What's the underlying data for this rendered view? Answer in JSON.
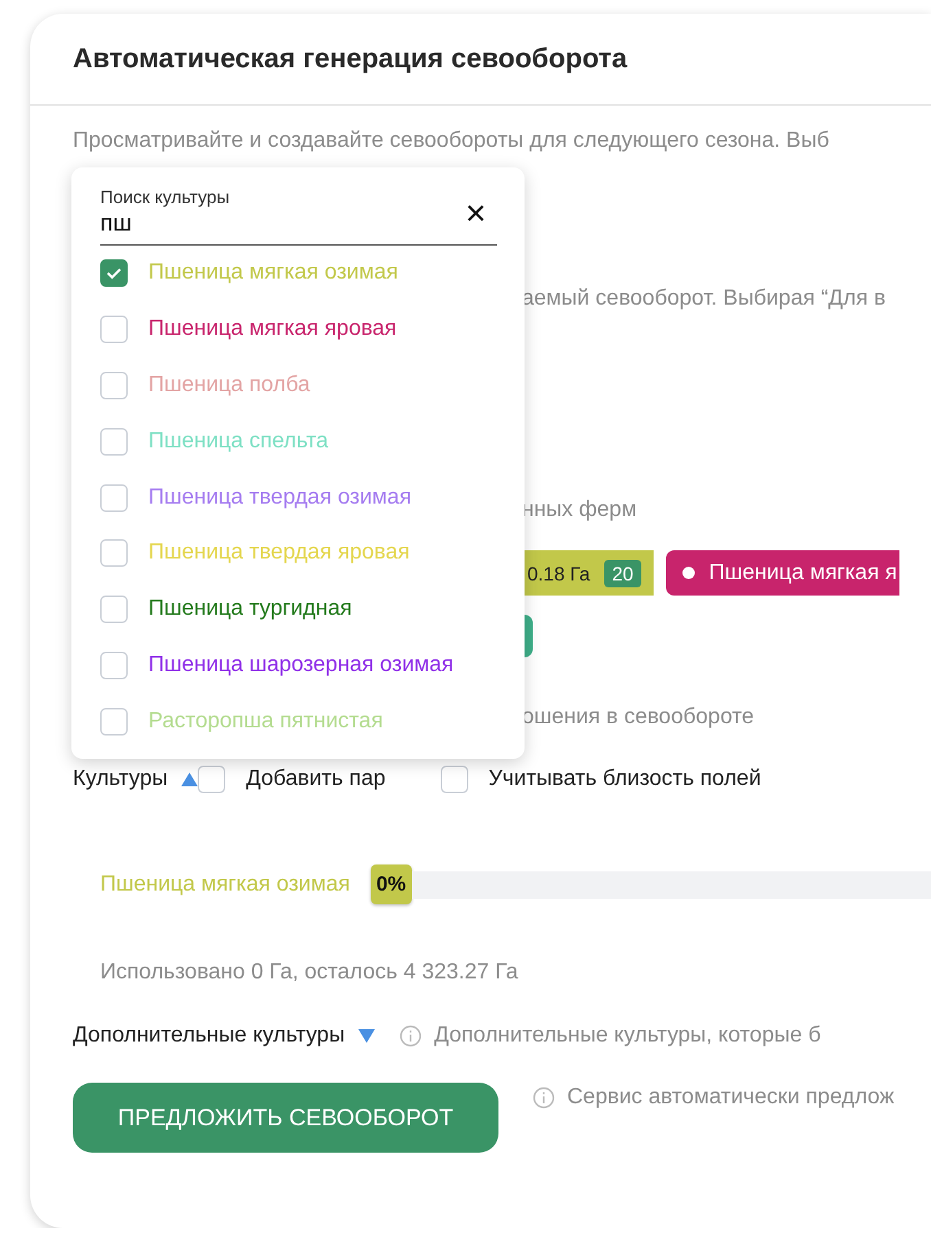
{
  "title": "Автоматическая генерация севооборота",
  "intro": "Просматривайте и создавайте севообороты для следующего сезона. Выб",
  "partial_texts": [
    "аемый севооборот. Выбирая “Для в",
    "нных ферм"
  ],
  "tags": [
    {
      "kind": "area",
      "text": "0.18 Га",
      "count": "20",
      "color": "#c2c84a"
    },
    {
      "kind": "crop",
      "text": "Пшеница мягкая я",
      "color": "#c8246c"
    }
  ],
  "partial_text_after": "ошения в севообороте",
  "culture_search": {
    "label": "Поиск культуры",
    "value": "пш",
    "close": "×",
    "options": [
      {
        "label": "Пшеница мягкая озимая",
        "color": "#c2c84a",
        "checked": true
      },
      {
        "label": "Пшеница мягкая яровая",
        "color": "#c8246c",
        "checked": false
      },
      {
        "label": "Пшеница полба",
        "color": "#e3a4a4",
        "checked": false
      },
      {
        "label": "Пшеница спельта",
        "color": "#7ee0c4",
        "checked": false
      },
      {
        "label": "Пшеница твердая озимая",
        "color": "#a57cf0",
        "checked": false
      },
      {
        "label": "Пшеница твердая яровая",
        "color": "#e4d64e",
        "checked": false
      },
      {
        "label": "Пшеница тургидная",
        "color": "#237a1c",
        "checked": false
      },
      {
        "label": "Пшеница шарозерная озимая",
        "color": "#9030e8",
        "checked": false
      },
      {
        "label": "Расторопша пятнистая",
        "color": "#b4dc90",
        "checked": false
      }
    ]
  },
  "cultures": {
    "label": "Культуры",
    "expanded": true,
    "options": [
      {
        "label": "Добавить пар",
        "checked": false
      },
      {
        "label": "Учитывать близость полей",
        "checked": false
      }
    ]
  },
  "allocations": [
    {
      "crop": "Пшеница мягкая озимая",
      "color": "#c2c84a",
      "percent": "0%",
      "level": 0
    }
  ],
  "usage": "Использовано 0 Га, осталось 4 323.27 Га",
  "extra": {
    "label": "Дополнительные культуры",
    "expanded": false,
    "hint": "Дополнительные культуры, которые б"
  },
  "submit": {
    "label": "ПРЕДЛОЖИТЬ СЕВООБОРОТ",
    "hint": "Сервис автоматически предлож"
  }
}
